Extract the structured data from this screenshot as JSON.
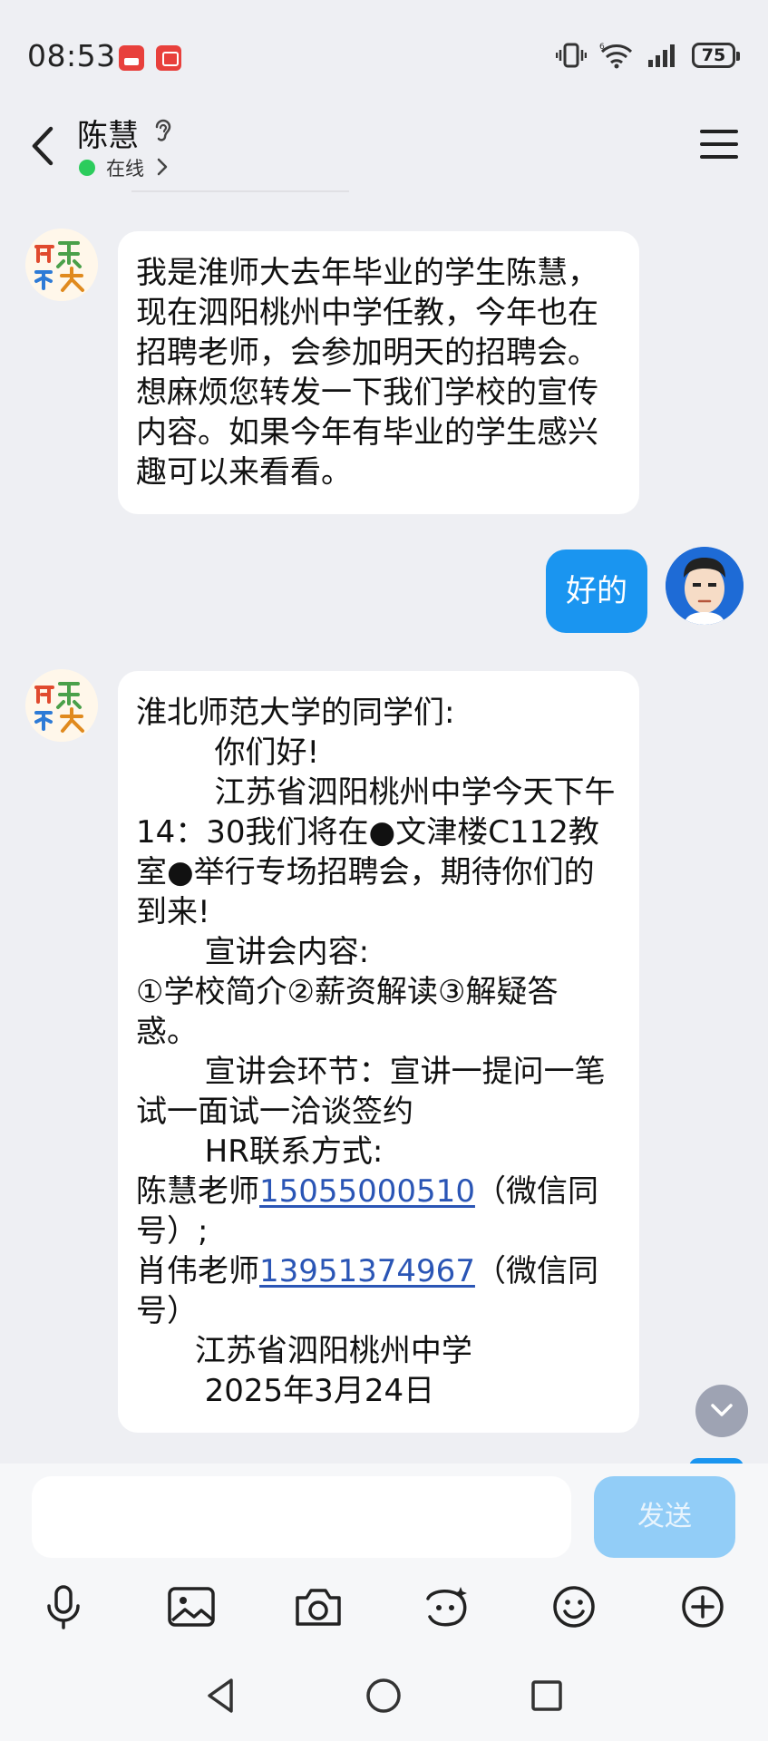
{
  "status_bar": {
    "time": "08:53",
    "battery": "75",
    "icons": [
      "vibrate-icon",
      "wifi-icon",
      "signal-icon",
      "battery-icon"
    ]
  },
  "header": {
    "contact_name": "陈慧",
    "status": "在线"
  },
  "messages": {
    "m1": "我是淮师大去年毕业的学生陈慧，现在泗阳桃州中学任教，今年也在招聘老师，会参加明天的招聘会。想麻烦您转发一下我们学校的宣传内容。如果今年有毕业的学生感兴趣可以来看看。",
    "m2": "好的",
    "m3": {
      "greeting": "淮北师范大学的同学们:",
      "hello": "        你们好!",
      "body1": "        江苏省泗阳桃州中学今天下午14：30我们将在●文津楼C112教室●举行专场招聘会，期待你们的到来!",
      "content_title": "       宣讲会内容:",
      "content": "①学校简介②薪资解读③解疑答惑。",
      "steps": "       宣讲会环节：宣讲一提问一笔试一面试一洽谈签约",
      "hr_title": "       HR联系方式:",
      "contact1_name": "陈慧老师",
      "contact1_phone": "15055000510",
      "contact1_suffix": "（微信同号）;",
      "contact2_name": "肖伟老师",
      "contact2_phone": "13951374967",
      "contact2_suffix": "（微信同号）",
      "school": "      江苏省泗阳桃州中学",
      "date": "       2025年3月24日"
    }
  },
  "input": {
    "value": "",
    "send_label": "发送"
  },
  "colors": {
    "accent": "#1a95f0",
    "send_disabled": "#92cdf7",
    "online": "#2ccc5c",
    "link": "#2a55b5",
    "background": "#eeeff3"
  }
}
